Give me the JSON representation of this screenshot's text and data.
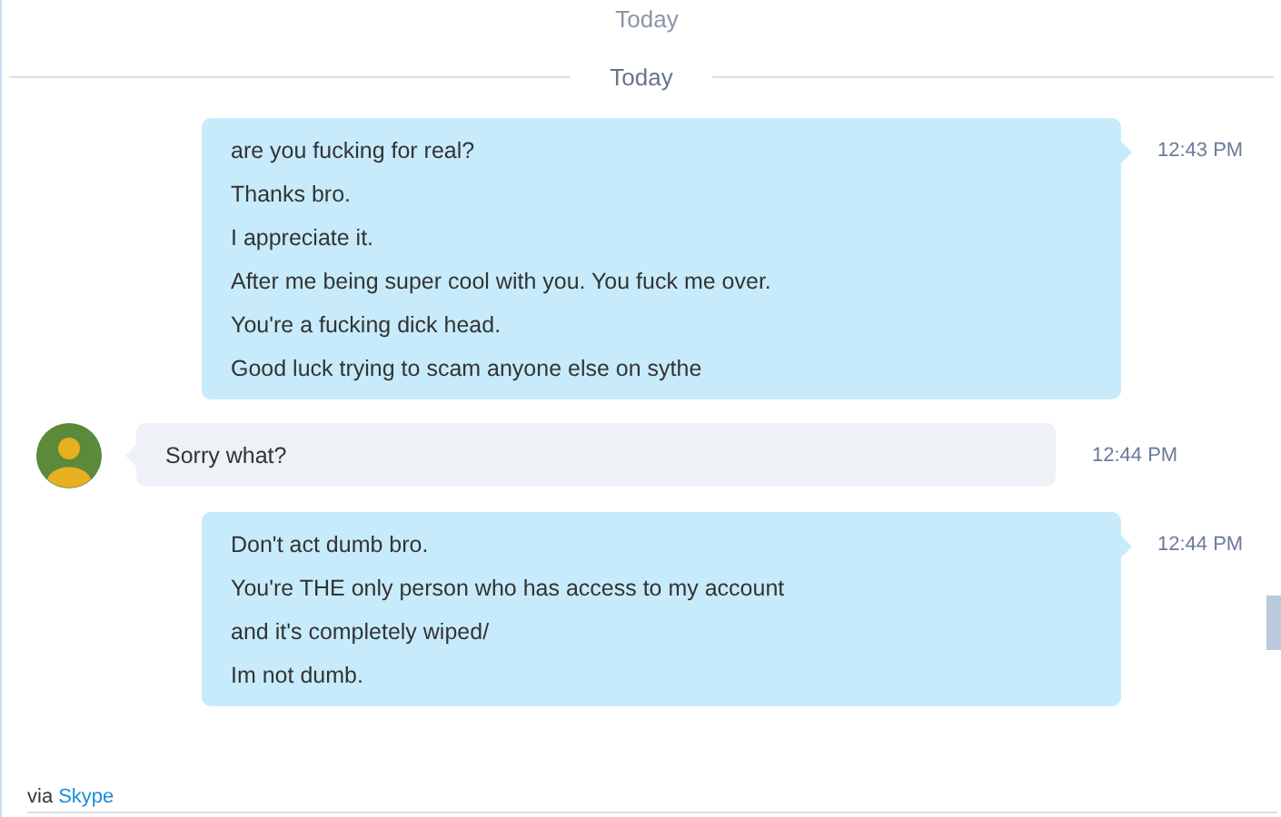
{
  "sticky_header": "Today",
  "day_divider": "Today",
  "messages": [
    {
      "kind": "outgoing",
      "time": "12:43 PM",
      "lines": [
        "are you fucking for real?",
        "Thanks bro.",
        "I appreciate it.",
        "After me being super cool with you. You fuck me over.",
        "You're a fucking dick head.",
        "Good luck trying to scam anyone else on sythe"
      ]
    },
    {
      "kind": "incoming",
      "time": "12:44 PM",
      "lines": [
        "Sorry what?"
      ]
    },
    {
      "kind": "outgoing",
      "time": "12:44 PM",
      "lines": [
        "Don't act dumb bro.",
        "You're THE only person who has access to my account",
        "and it's completely wiped/",
        "Im not dumb."
      ]
    }
  ],
  "footer": {
    "prefix": "via",
    "link": "Skype"
  }
}
